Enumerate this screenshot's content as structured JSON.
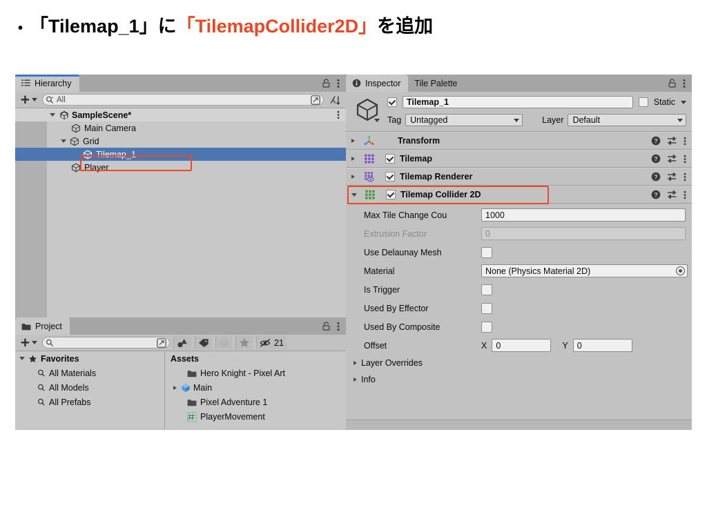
{
  "slide": {
    "bullet": "•",
    "title_part1": "「Tilemap_1」に",
    "title_highlight": "「TilemapCollider2D」",
    "title_part2": "を追加"
  },
  "hierarchy": {
    "tab_label": "Hierarchy",
    "tab_icon": "list-icon",
    "lock_icon": "lock-icon",
    "menu_icon": "kebab-menu-icon",
    "add_label": "+",
    "search_placeholder": "All",
    "search_icon": "search-icon",
    "expand_icon": "expand-window-icon",
    "sort_icon": "sort-icon",
    "rows": [
      {
        "label": "SampleScene*",
        "icon": "unity-scene-icon",
        "depth": 0,
        "expanded": true,
        "selected": false,
        "bold": true
      },
      {
        "label": "Main Camera",
        "icon": "gameobject-cube-icon",
        "depth": 1,
        "expanded": null,
        "selected": false,
        "bold": false
      },
      {
        "label": "Grid",
        "icon": "gameobject-cube-icon",
        "depth": 1,
        "expanded": true,
        "selected": false,
        "bold": false
      },
      {
        "label": "Tilemap_1",
        "icon": "gameobject-cube-icon",
        "depth": 2,
        "expanded": null,
        "selected": true,
        "bold": false
      },
      {
        "label": "Player",
        "icon": "gameobject-cube-icon",
        "depth": 1,
        "expanded": null,
        "selected": false,
        "bold": false
      }
    ]
  },
  "project": {
    "tab_label": "Project",
    "tab_icon": "folder-icon",
    "lock_icon": "lock-icon",
    "menu_icon": "kebab-menu-icon",
    "add_label": "+",
    "search_placeholder": "",
    "search_icon": "search-icon",
    "expand_icon": "expand-window-icon",
    "toolbar_icons": [
      "shapes-filter-icon",
      "label-tag-icon",
      "warning-icon",
      "star-favorite-icon",
      "hidden-eye-icon"
    ],
    "hidden_count": "21",
    "favorites": {
      "label": "Favorites",
      "icon": "star-icon",
      "items": [
        {
          "label": "All Materials",
          "icon": "search-icon"
        },
        {
          "label": "All Models",
          "icon": "search-icon"
        },
        {
          "label": "All Prefabs",
          "icon": "search-icon"
        }
      ]
    },
    "assets": {
      "label": "Assets",
      "items": [
        {
          "label": "Hero Knight - Pixel Art",
          "icon": "folder-icon",
          "expandable": false
        },
        {
          "label": "Main",
          "icon": "prefab-cube-icon",
          "expandable": true
        },
        {
          "label": "Pixel Adventure 1",
          "icon": "folder-icon",
          "expandable": false
        },
        {
          "label": "PlayerMovement",
          "icon": "csharp-script-icon",
          "expandable": false
        }
      ]
    }
  },
  "inspector": {
    "tabs": [
      {
        "label": "Inspector",
        "icon": "info-icon",
        "active": true
      },
      {
        "label": "Tile Palette",
        "icon": "",
        "active": false
      }
    ],
    "lock_icon": "lock-icon",
    "menu_icon": "kebab-menu-icon",
    "object_icon": "gameobject-cube-icon",
    "enabled_checkbox": true,
    "object_name": "Tilemap_1",
    "static_label": "Static",
    "static_checked": false,
    "tag_label": "Tag",
    "tag_value": "Untagged",
    "layer_label": "Layer",
    "layer_value": "Default",
    "components": [
      {
        "name": "Transform",
        "icon": "transform-axis-icon",
        "has_toggle": false,
        "enabled": false,
        "expanded": false,
        "highlighted": false
      },
      {
        "name": "Tilemap",
        "icon": "tilemap-grid-icon",
        "has_toggle": true,
        "enabled": true,
        "expanded": false,
        "highlighted": false
      },
      {
        "name": "Tilemap Renderer",
        "icon": "tilemap-renderer-icon",
        "has_toggle": true,
        "enabled": true,
        "expanded": false,
        "highlighted": false
      },
      {
        "name": "Tilemap Collider 2D",
        "icon": "tilemap-collider-icon",
        "has_toggle": true,
        "enabled": true,
        "expanded": true,
        "highlighted": true
      }
    ],
    "component_row_icons": [
      "help-icon",
      "preset-icon",
      "kebab-menu-icon"
    ],
    "collider_properties": [
      {
        "label": "Max Tile Change Cou",
        "type": "number",
        "value": "1000",
        "disabled": false
      },
      {
        "label": "Extrusion Factor",
        "type": "number",
        "value": "0",
        "disabled": true
      },
      {
        "label": "Use Delaunay Mesh",
        "type": "checkbox",
        "value": false,
        "disabled": false
      },
      {
        "label": "Material",
        "type": "object",
        "value": "None (Physics Material 2D)",
        "disabled": false
      },
      {
        "label": "Is Trigger",
        "type": "checkbox",
        "value": false,
        "disabled": false
      },
      {
        "label": "Used By Effector",
        "type": "checkbox",
        "value": false,
        "disabled": false
      },
      {
        "label": "Used By Composite",
        "type": "checkbox",
        "value": false,
        "disabled": false
      }
    ],
    "offset": {
      "label": "Offset",
      "x_label": "X",
      "x_value": "0",
      "y_label": "Y",
      "y_value": "0"
    },
    "foldouts": [
      {
        "label": "Layer Overrides",
        "expanded": false
      },
      {
        "label": "Info",
        "expanded": false
      }
    ]
  },
  "colors": {
    "accent_red": "#ef4623",
    "selection_blue": "#4c76b2",
    "tab_active_blue": "#3a78c8",
    "panel_bg": "#c2c2c2",
    "tile_icon_purple": "#7a52cc",
    "collider_icon_green": "#3f9a42"
  }
}
